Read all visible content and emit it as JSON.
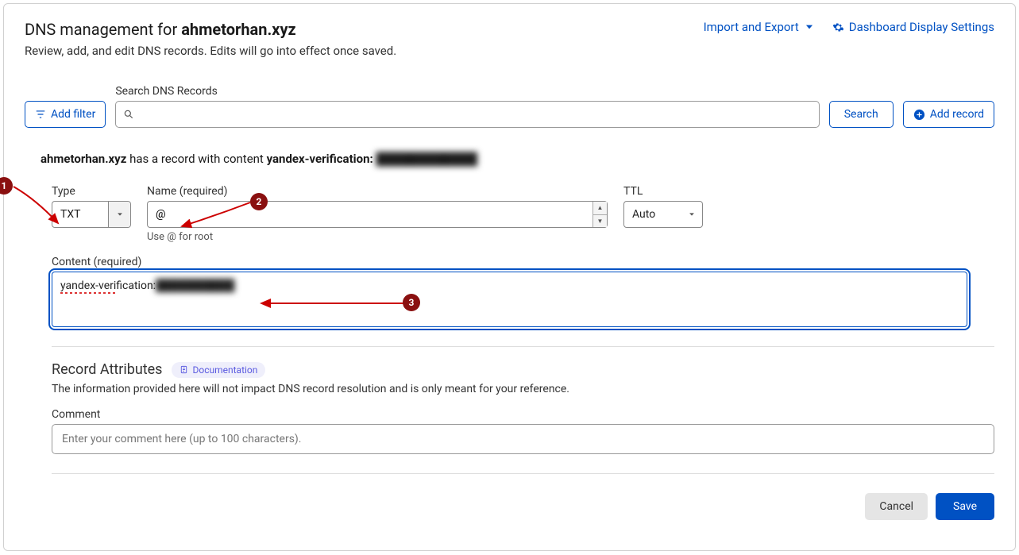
{
  "header": {
    "title_prefix": "DNS management for ",
    "domain": "ahmetorhan.xyz",
    "subtitle": "Review, add, and edit DNS records. Edits will go into effect once saved.",
    "import_export": "Import and Export",
    "display_settings": "Dashboard Display Settings"
  },
  "filter": {
    "add_filter": "Add filter",
    "search_label": "Search DNS Records",
    "search_value": "",
    "search_btn": "Search",
    "add_record_btn": "Add record"
  },
  "record_status": {
    "domain": "ahmetorhan.xyz",
    "mid": " has a record with content ",
    "content_label": "yandex-verification:",
    "content_value_masked": "████████████"
  },
  "form": {
    "type": {
      "label": "Type",
      "value": "TXT"
    },
    "name": {
      "label": "Name (required)",
      "value": "@",
      "helper": "Use @ for root"
    },
    "ttl": {
      "label": "TTL",
      "value": "Auto"
    },
    "content": {
      "label": "Content (required)",
      "value_prefix": "yandex-verification: ",
      "value_masked": "██████████"
    }
  },
  "attributes": {
    "title": "Record Attributes",
    "doc_label": "Documentation",
    "description": "The information provided here will not impact DNS record resolution and is only meant for your reference.",
    "comment_label": "Comment",
    "comment_placeholder": "Enter your comment here (up to 100 characters)."
  },
  "actions": {
    "cancel": "Cancel",
    "save": "Save"
  },
  "annotations": {
    "m1": "1",
    "m2": "2",
    "m3": "3"
  }
}
